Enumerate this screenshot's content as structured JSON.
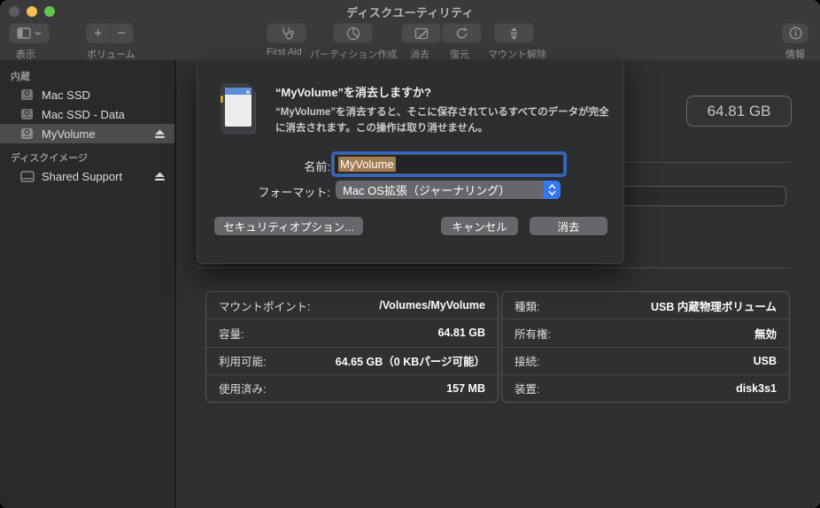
{
  "window": {
    "title": "ディスクユーティリティ"
  },
  "toolbar": {
    "view_label": "表示",
    "volume_label": "ボリューム",
    "first_aid_label": "First Aid",
    "partition_label": "パーティション作成",
    "erase_label": "消去",
    "restore_label": "復元",
    "unmount_label": "マウント解除",
    "info_label": "情報"
  },
  "sidebar": {
    "sections": [
      {
        "title": "内蔵",
        "items": [
          {
            "label": "Mac SSD"
          },
          {
            "label": "Mac SSD - Data"
          },
          {
            "label": "MyVolume",
            "selected": true,
            "eject": true
          }
        ]
      },
      {
        "title": "ディスクイメージ",
        "items": [
          {
            "label": "Shared Support",
            "eject": true
          }
        ]
      }
    ]
  },
  "content": {
    "capacity_badge": "64.81 GB"
  },
  "dialog": {
    "title": "“MyVolume”を消去しますか?",
    "body": "“MyVolume”を消去すると、そこに保存されているすべてのデータが完全に消去されます。この操作は取り消せません。",
    "name_label": "名前:",
    "name_value": "MyVolume",
    "format_label": "フォーマット:",
    "format_value": "Mac OS拡張（ジャーナリング）",
    "security_button": "セキュリティオプション...",
    "cancel_button": "キャンセル",
    "erase_button": "消去"
  },
  "info_left": {
    "rows": [
      {
        "label": "マウントポイント:",
        "value": "/Volumes/MyVolume"
      },
      {
        "label": "容量:",
        "value": "64.81 GB"
      },
      {
        "label": "利用可能:",
        "value": "64.65 GB（0 KBパージ可能）"
      },
      {
        "label": "使用済み:",
        "value": "157 MB"
      }
    ]
  },
  "info_right": {
    "rows": [
      {
        "label": "種類:",
        "value": "USB 内蔵物理ボリューム"
      },
      {
        "label": "所有権:",
        "value": "無効"
      },
      {
        "label": "接続:",
        "value": "USB"
      },
      {
        "label": "装置:",
        "value": "disk3s1"
      }
    ]
  },
  "colors": {
    "focus_ring_blue": "#3071e3",
    "popup_accent_blue": "#3577f3",
    "text_selection_tan": "#a27b50",
    "traffic_yellow": "#f6be50",
    "traffic_green": "#63c64f"
  }
}
